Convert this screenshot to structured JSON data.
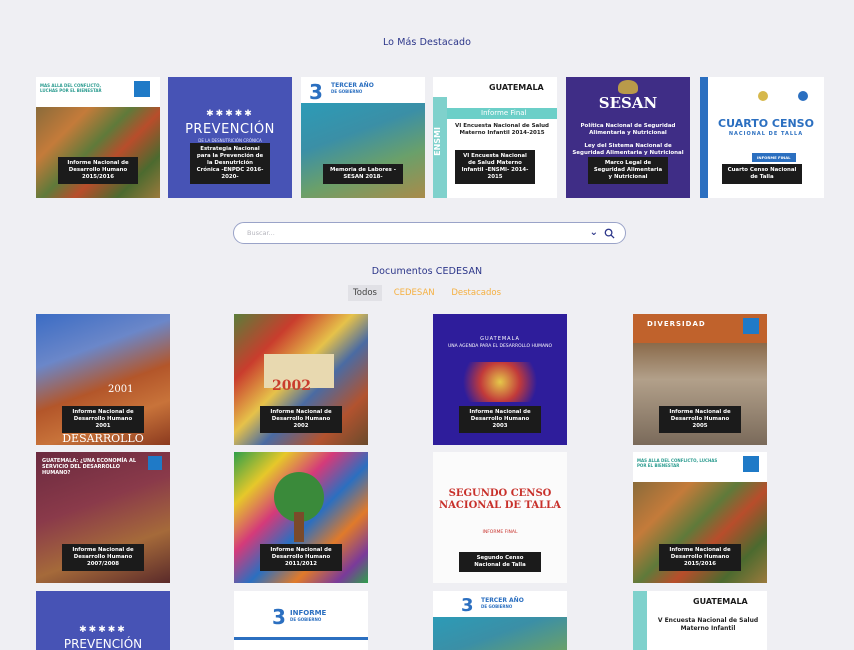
{
  "featured": {
    "title": "Lo Más Destacado",
    "items": [
      {
        "label": "Informe Nacional de Desarrollo Humano 2015/2016",
        "cover": "MAS ALLA DEL CONFLICTO, LUCHAS POR EL BIENESTAR"
      },
      {
        "label": "Estrategia Nacional para la Prevención de la Desnutrición Crónica -ENPDC 2016-2020-",
        "cover": "PREVENCIÓN",
        "cover_sub": "DE LA DESNUTRICIÓN CRÓNICA"
      },
      {
        "label": "Memoria de Labores -SESAN 2018-",
        "cover": "TERCER AÑO",
        "cover_sub": "DE GOBIERNO"
      },
      {
        "label": "VI Encuesta Nacional de Salud Materno Infantil -ENSMI- 2014-2015",
        "cover": "GUATEMALA",
        "cover_sub": "Informe Final",
        "cover_body": "VI Encuesta Nacional de Salud Materno Infantil 2014-2015",
        "cover_side": "ENSMI"
      },
      {
        "label": "Marco Legal de Seguridad Alimentaria y Nutricional",
        "cover": "SESAN",
        "cover_body": "Política Nacional de Seguridad Alimentaria y Nutricional",
        "cover_body2": "Ley del Sistema Nacional de Seguridad Alimentaria y Nutricional"
      },
      {
        "label": "Cuarto Censo Nacional de Talla",
        "cover": "CUARTO CENSO",
        "cover_sub": "NACIONAL DE TALLA",
        "cover_tag": "INFORME FINAL"
      }
    ]
  },
  "search": {
    "placeholder": "Buscar..."
  },
  "documents": {
    "title": "Documentos CEDESAN",
    "filters": [
      {
        "label": "Todos",
        "active": true
      },
      {
        "label": "CEDESAN",
        "active": false
      },
      {
        "label": "Destacados",
        "active": false
      }
    ],
    "items": [
      {
        "label": "Informe Nacional de Desarrollo Humano 2001",
        "cover": "DESARROLLO",
        "year": "2001"
      },
      {
        "label": "Informe Nacional de Desarrollo Humano 2002",
        "year": "2002"
      },
      {
        "label": "Informe Nacional de Desarrollo Humano 2003",
        "cover": "GUATEMALA",
        "cover_sub": "UNA AGENDA PARA EL DESARROLLO HUMANO"
      },
      {
        "label": "Informe Nacional de Desarrollo Humano 2005",
        "cover": "DIVERSIDAD"
      },
      {
        "label": "Informe Nacional de Desarrollo Humano 2007/2008",
        "cover": "GUATEMALA: ¿UNA ECONOMÍA AL SERVICIO DEL DESARROLLO HUMANO?"
      },
      {
        "label": "Informe Nacional de Desarrollo Humano 2011/2012"
      },
      {
        "label": "Segundo Censo Nacional de Talla",
        "cover": "SEGUNDO CENSO",
        "cover_sub": "NACIONAL DE TALLA",
        "cover_tag": "INFORME FINAL"
      },
      {
        "label": "Informe Nacional de Desarrollo Humano 2015/2016",
        "cover": "MAS ALLA DEL CONFLICTO, LUCHAS POR EL BIENESTAR"
      },
      {
        "cover": "PREVENCIÓN"
      },
      {
        "cover": "INFORME",
        "cover_sub": "DE GOBIERNO"
      },
      {
        "cover": "TERCER AÑO",
        "cover_sub": "DE GOBIERNO"
      },
      {
        "cover": "GUATEMALA",
        "cover_body": "V Encuesta Nacional de Salud Materno Infantil"
      }
    ]
  },
  "colors": {
    "accent": "#2b3589",
    "filter": "#f5b041",
    "page": "#efeff3",
    "label_bg": "#1b1b1b"
  }
}
